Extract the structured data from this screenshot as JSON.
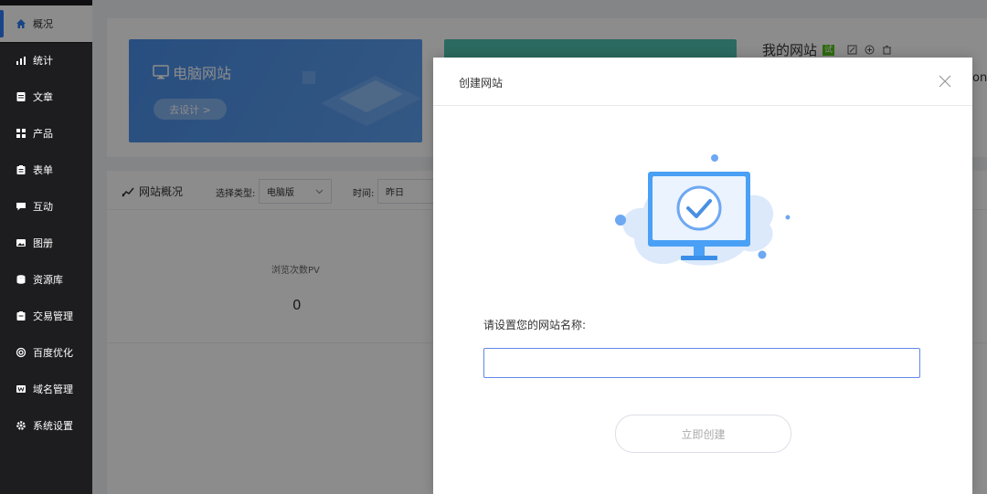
{
  "sidebar": {
    "items": [
      {
        "label": "概况",
        "icon": "home-icon"
      },
      {
        "label": "统计",
        "icon": "chart-icon"
      },
      {
        "label": "文章",
        "icon": "article-icon"
      },
      {
        "label": "产品",
        "icon": "product-icon"
      },
      {
        "label": "表单",
        "icon": "form-icon"
      },
      {
        "label": "互动",
        "icon": "chat-icon"
      },
      {
        "label": "图册",
        "icon": "gallery-icon"
      },
      {
        "label": "资源库",
        "icon": "database-icon"
      },
      {
        "label": "交易管理",
        "icon": "order-icon"
      },
      {
        "label": "百度优化",
        "icon": "seo-icon"
      },
      {
        "label": "域名管理",
        "icon": "domain-icon"
      },
      {
        "label": "系统设置",
        "icon": "gear-icon"
      }
    ]
  },
  "banner": {
    "title": "电脑网站",
    "design_button": "去设计 >"
  },
  "site_info": {
    "title": "我的网站",
    "trial_badge": "试",
    "partial_text": "on"
  },
  "overview": {
    "title": "网站概况",
    "type_label": "选择类型:",
    "type_value": "电脑版",
    "time_label": "时间:",
    "time_value": "昨日",
    "pv_label": "浏览次数PV",
    "pv_value": "0"
  },
  "modal": {
    "title": "创建网站",
    "prompt": "请设置您的网站名称:",
    "input_value": "",
    "create_button": "立即创建"
  },
  "colors": {
    "accent": "#2f7cf6",
    "banner_blue": "#4a8fe8",
    "teal": "#4fc1b0",
    "sidebar_bg": "#1d1d1f"
  }
}
